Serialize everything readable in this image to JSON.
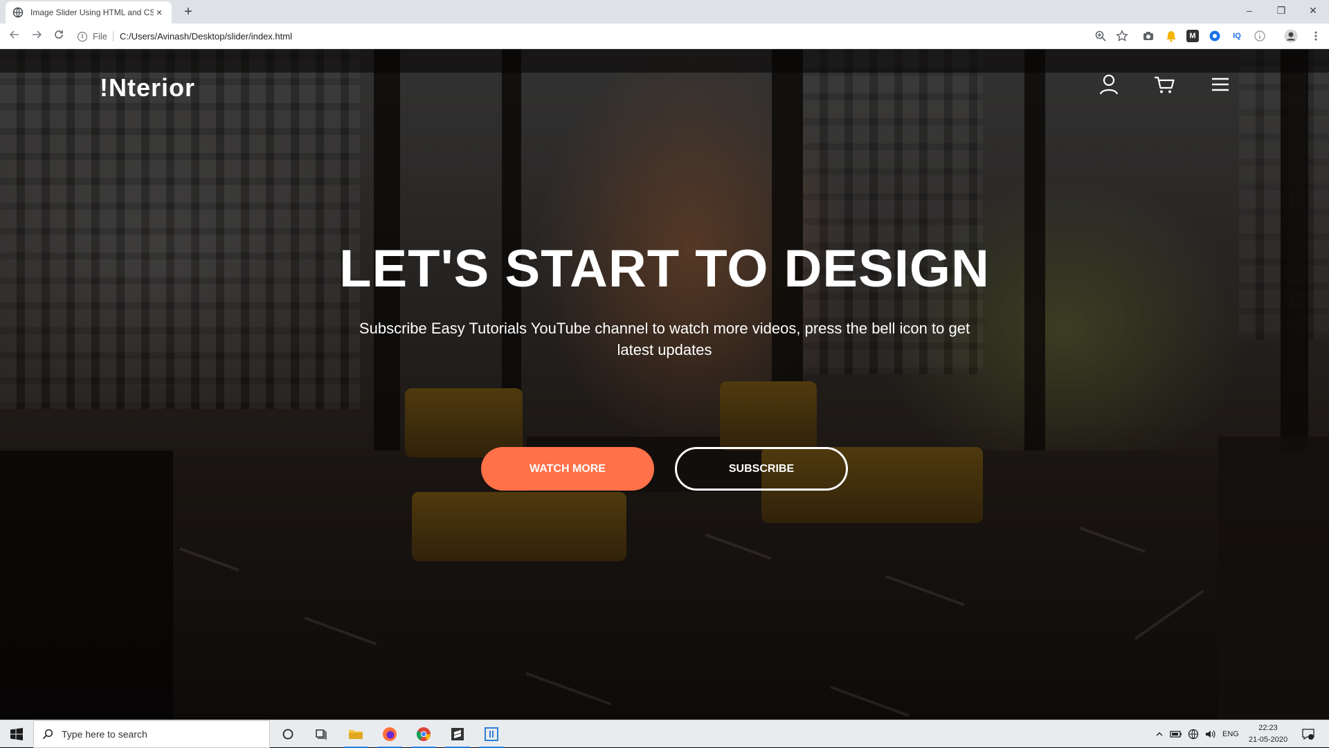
{
  "browser": {
    "tab_title": "Image Slider Using HTML and CSS",
    "tab_close": "×",
    "new_tab": "+",
    "address_prefix": "File",
    "address_url": "C:/Users/Avinash/Desktop/slider/index.html",
    "window_controls": [
      "–",
      "❐",
      "✕"
    ],
    "extensions": [
      "zoom-icon",
      "star-icon",
      "camera-icon",
      "bell-extension-icon",
      "m-extension-icon",
      "blue-extension-icon",
      "iq-extension-icon",
      "info-extension-icon",
      "profile-avatar",
      "more-menu-icon"
    ],
    "ext_labels": {
      "m": "M",
      "iq": "IQ"
    }
  },
  "site": {
    "logo": "!Nterior",
    "nav_icons": [
      "user-icon",
      "cart-icon",
      "hamburger-menu-icon"
    ],
    "hero": {
      "title": "LET'S START TO DESIGN",
      "subtitle": "Subscribe Easy Tutorials YouTube channel to watch more videos, press the bell icon to get latest updates",
      "primary_button": "WATCH MORE",
      "secondary_button": "SUBSCRIBE"
    },
    "accent_color": "#ff7148"
  },
  "taskbar": {
    "search_placeholder": "Type here to search",
    "apps": [
      "cortana-icon",
      "task-view-icon",
      "file-explorer-icon",
      "firefox-icon",
      "chrome-icon",
      "sublime-icon",
      "snip-icon"
    ],
    "tray_language": "ENG",
    "time": "22:23",
    "date": "21-05-2020"
  }
}
